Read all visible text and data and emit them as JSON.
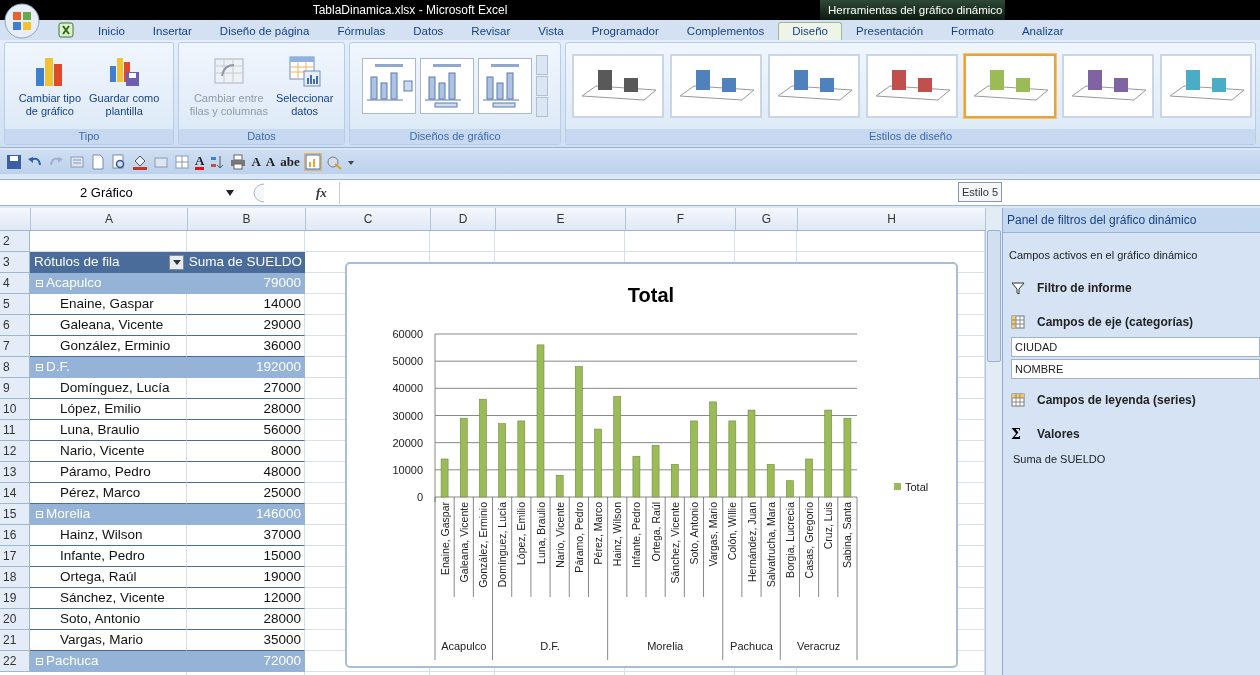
{
  "window": {
    "title": "TablaDinamica.xlsx - Microsoft Excel",
    "context_title": "Herramientas del gráfico dinámico"
  },
  "ribbon_tabs": [
    {
      "label": "Inicio",
      "selected": false
    },
    {
      "label": "Insertar",
      "selected": false
    },
    {
      "label": "Diseño de página",
      "selected": false
    },
    {
      "label": "Fórmulas",
      "selected": false
    },
    {
      "label": "Datos",
      "selected": false
    },
    {
      "label": "Revisar",
      "selected": false
    },
    {
      "label": "Vista",
      "selected": false
    },
    {
      "label": "Programador",
      "selected": false
    },
    {
      "label": "Complementos",
      "selected": false
    },
    {
      "label": "Diseño",
      "selected": true
    },
    {
      "label": "Presentación",
      "selected": false
    },
    {
      "label": "Formato",
      "selected": false
    },
    {
      "label": "Analizar",
      "selected": false
    }
  ],
  "ribbon_groups": [
    {
      "kind": "buttons",
      "label": "Tipo",
      "buttons": [
        {
          "kind": "chart_type",
          "label": "Cambiar tipo\nde gráfico",
          "disabled": false
        },
        {
          "kind": "save_template",
          "label": "Guardar como\nplantilla",
          "disabled": false
        }
      ]
    },
    {
      "kind": "buttons",
      "label": "Datos",
      "buttons": [
        {
          "kind": "switch",
          "label": "Cambiar entre\nfilas y columnas",
          "disabled": true
        },
        {
          "kind": "select_data",
          "label": "Seleccionar\ndatos",
          "disabled": false
        }
      ]
    },
    {
      "kind": "layouts",
      "label": "Diseños de gráfico"
    },
    {
      "kind": "styles",
      "label": "Estilos de diseño",
      "styles": [
        {
          "color": "#595959",
          "selected": false
        },
        {
          "color": "#4f81bd",
          "selected": false
        },
        {
          "color": "#4f81bd",
          "selected": false
        },
        {
          "color": "#c0504d",
          "selected": false
        },
        {
          "color": "#9bbb59",
          "selected": true
        },
        {
          "color": "#8064a2",
          "selected": false
        },
        {
          "color": "#4bacc6",
          "selected": false
        }
      ]
    }
  ],
  "quick_access": [
    {
      "kind": "save"
    },
    {
      "kind": "undo"
    },
    {
      "kind": "redo"
    },
    {
      "kind": "form"
    },
    {
      "kind": "page"
    },
    {
      "kind": "preview"
    },
    {
      "kind": "fill"
    },
    {
      "kind": "box"
    },
    {
      "kind": "grid"
    },
    {
      "kind": "font_color",
      "text": "A"
    },
    {
      "kind": "sort"
    },
    {
      "kind": "print"
    },
    {
      "kind": "glyph",
      "text": "A"
    },
    {
      "kind": "glyph",
      "text": "A"
    },
    {
      "kind": "glyph",
      "text": "abe"
    },
    {
      "kind": "chart"
    },
    {
      "kind": "tools"
    },
    {
      "kind": "customize"
    }
  ],
  "name_box": {
    "value": "2 Gráfico"
  },
  "formula_bar": {
    "function_label": "fx"
  },
  "tooltip": "Estilo 5",
  "columns": [
    "A",
    "B",
    "C",
    "D",
    "E",
    "F",
    "G",
    "H"
  ],
  "rows": [
    {
      "number": "2",
      "kind": "blank"
    },
    {
      "number": "3",
      "kind": "header",
      "label": "Rótulos de fila",
      "value": "Suma de SUELDO"
    },
    {
      "number": "4",
      "kind": "group",
      "label": "Acapulco",
      "value": "79000",
      "expanded": true
    },
    {
      "number": "5",
      "kind": "item",
      "label": "Enaine, Gaspar",
      "value": "14000"
    },
    {
      "number": "6",
      "kind": "item",
      "label": "Galeana, Vicente",
      "value": "29000"
    },
    {
      "number": "7",
      "kind": "item",
      "label": "González, Erminio",
      "value": "36000"
    },
    {
      "number": "8",
      "kind": "group",
      "label": "D.F.",
      "value": "192000",
      "expanded": true
    },
    {
      "number": "9",
      "kind": "item",
      "label": "Domínguez, Lucía",
      "value": "27000"
    },
    {
      "number": "10",
      "kind": "item",
      "label": "López, Emilio",
      "value": "28000"
    },
    {
      "number": "11",
      "kind": "item",
      "label": "Luna, Braulio",
      "value": "56000"
    },
    {
      "number": "12",
      "kind": "item",
      "label": "Nario, Vicente",
      "value": "8000"
    },
    {
      "number": "13",
      "kind": "item",
      "label": "Páramo, Pedro",
      "value": "48000"
    },
    {
      "number": "14",
      "kind": "item",
      "label": "Pérez, Marco",
      "value": "25000"
    },
    {
      "number": "15",
      "kind": "group",
      "label": "Morelia",
      "value": "146000",
      "expanded": true
    },
    {
      "number": "16",
      "kind": "item",
      "label": "Hainz, Wilson",
      "value": "37000"
    },
    {
      "number": "17",
      "kind": "item",
      "label": "Infante, Pedro",
      "value": "15000"
    },
    {
      "number": "18",
      "kind": "item",
      "label": "Ortega, Raúl",
      "value": "19000"
    },
    {
      "number": "19",
      "kind": "item",
      "label": "Sánchez, Vicente",
      "value": "12000"
    },
    {
      "number": "20",
      "kind": "item",
      "label": "Soto, Antonio",
      "value": "28000"
    },
    {
      "number": "21",
      "kind": "item",
      "label": "Vargas, Mario",
      "value": "35000"
    },
    {
      "number": "22",
      "kind": "group",
      "label": "Pachuca",
      "value": "72000",
      "expanded": true
    }
  ],
  "chart": {
    "chart_data": {
      "type": "bar",
      "title": "Total",
      "categories": [
        "Enaine, Gaspar",
        "Galeana, Vicente",
        "González, Erminio",
        "Domínguez, Lucía",
        "López, Emilio",
        "Luna, Braulio",
        "Nario, Vicente",
        "Páramo, Pedro",
        "Pérez, Marco",
        "Hainz, Wilson",
        "Infante, Pedro",
        "Ortega, Raúl",
        "Sánchez, Vicente",
        "Soto, Antonio",
        "Vargas, Mario",
        "Colón, Willie",
        "Hernández, Juan",
        "Salvatrucha, Mara",
        "Borgia, Lucrecia",
        "Casas, Gregorio",
        "Cruz, Luis",
        "Sabina, Santa"
      ],
      "series": [
        {
          "name": "Total",
          "color": "#9bbb59",
          "values": [
            14000,
            29000,
            36000,
            27000,
            28000,
            56000,
            8000,
            48000,
            25000,
            37000,
            15000,
            19000,
            12000,
            28000,
            35000,
            28000,
            32000,
            12000,
            6000,
            14000,
            32000,
            29000
          ]
        }
      ],
      "ylim": [
        0,
        60000
      ],
      "yticks": [
        0,
        10000,
        20000,
        30000,
        40000,
        50000,
        60000
      ],
      "grid": true,
      "annotations": [
        "Acapulco",
        "D.F.",
        "Morelia",
        "Pachuca",
        "Veracruz"
      ]
    }
  },
  "filter_panel": {
    "title": "Panel de filtros del gráfico dinámico",
    "subtitle": "Campos activos en el gráfico dinámico",
    "sections": [
      {
        "kind": "filter",
        "title": "Filtro de informe"
      },
      {
        "kind": "axis",
        "title": "Campos de eje (categorías)",
        "fields": [
          "CIUDAD",
          "NOMBRE"
        ]
      },
      {
        "kind": "legend",
        "title": "Campos de leyenda (series)"
      },
      {
        "kind": "values",
        "symbol": "Σ",
        "title": "Valores",
        "fields": [
          "Suma de SUELDO"
        ]
      }
    ]
  }
}
